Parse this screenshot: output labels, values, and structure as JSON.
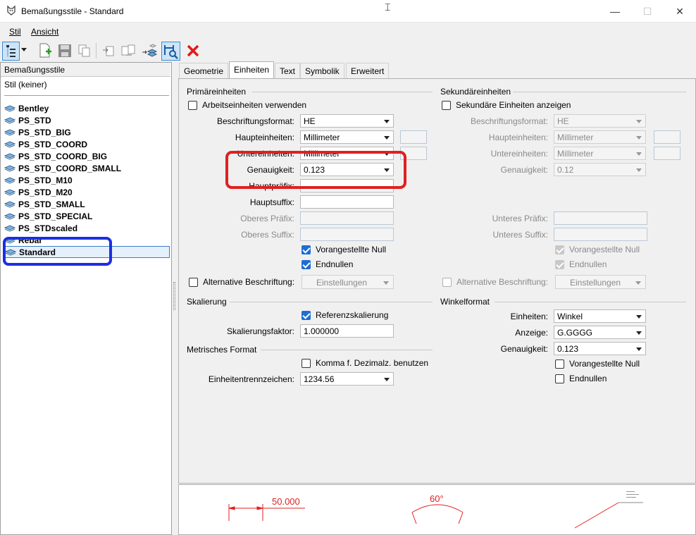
{
  "window": {
    "title": "Bemaßungsstile - Standard",
    "minimize": "—",
    "maximize": "☐",
    "close": "✕"
  },
  "menu": {
    "stil": "Stil",
    "ansicht": "Ansicht"
  },
  "left": {
    "header": "Bemaßungsstile",
    "stil_keiner": "Stil (keiner)",
    "items": [
      "Bentley",
      "PS_STD",
      "PS_STD_BIG",
      "PS_STD_COORD",
      "PS_STD_COORD_BIG",
      "PS_STD_COORD_SMALL",
      "PS_STD_M10",
      "PS_STD_M20",
      "PS_STD_SMALL",
      "PS_STD_SPECIAL",
      "PS_STDscaled",
      "Rebar",
      "Standard"
    ],
    "selected": "Standard"
  },
  "tabs": [
    "Geometrie",
    "Einheiten",
    "Text",
    "Symbolik",
    "Erweitert"
  ],
  "active_tab": "Einheiten",
  "primary": {
    "title": "Primäreinheiten",
    "use_work_units": "Arbeitseinheiten verwenden",
    "label_format_label": "Beschriftungsformat:",
    "label_format": "HE",
    "master_label": "Haupteinheiten:",
    "master": "Millimeter",
    "sub_label": "Untereinheiten:",
    "sub": "Millimeter",
    "accuracy_label": "Genauigkeit:",
    "accuracy": "0.123",
    "main_prefix_label": "Hauptpräfix:",
    "main_suffix_label": "Hauptsuffix:",
    "upper_prefix_label": "Oberes Präfix:",
    "upper_suffix_label": "Oberes Suffix:",
    "leading_zero": "Vorangestellte Null",
    "trailing_zeros": "Endnullen",
    "alt_label": "Alternative Beschriftung:",
    "settings": "Einstellungen"
  },
  "secondary": {
    "title": "Sekundäreinheiten",
    "show": "Sekundäre Einheiten anzeigen",
    "label_format_label": "Beschriftungsformat:",
    "label_format": "HE",
    "master_label": "Haupteinheiten:",
    "master": "Millimeter",
    "sub_label": "Untereinheiten:",
    "sub": "Millimeter",
    "accuracy_label": "Genauigkeit:",
    "accuracy": "0.12",
    "lower_prefix_label": "Unteres Präfix:",
    "lower_suffix_label": "Unteres Suffix:",
    "leading_zero": "Vorangestellte Null",
    "trailing_zeros": "Endnullen",
    "alt_label": "Alternative Beschriftung:",
    "settings": "Einstellungen"
  },
  "scaling": {
    "title": "Skalierung",
    "ref_scaling": "Referenzskalierung",
    "factor_label": "Skalierungsfaktor:",
    "factor": "1.000000"
  },
  "metric": {
    "title": "Metrisches Format",
    "comma": "Komma f. Dezimalz. benutzen",
    "sep_label": "Einheitentrennzeichen:",
    "sep": "1234.56"
  },
  "angle": {
    "title": "Winkelformat",
    "units_label": "Einheiten:",
    "units": "Winkel",
    "display_label": "Anzeige:",
    "display": "G.GGGG",
    "accuracy_label": "Genauigkeit:",
    "accuracy": "0.123",
    "leading_zero": "Vorangestellte Null",
    "trailing_zeros": "Endnullen"
  },
  "preview": {
    "linear": "50.000",
    "angle": "60°"
  },
  "colors": {
    "highlight_red": "#e02020",
    "highlight_blue": "#1c2ee0",
    "preview_red": "#e02020"
  }
}
